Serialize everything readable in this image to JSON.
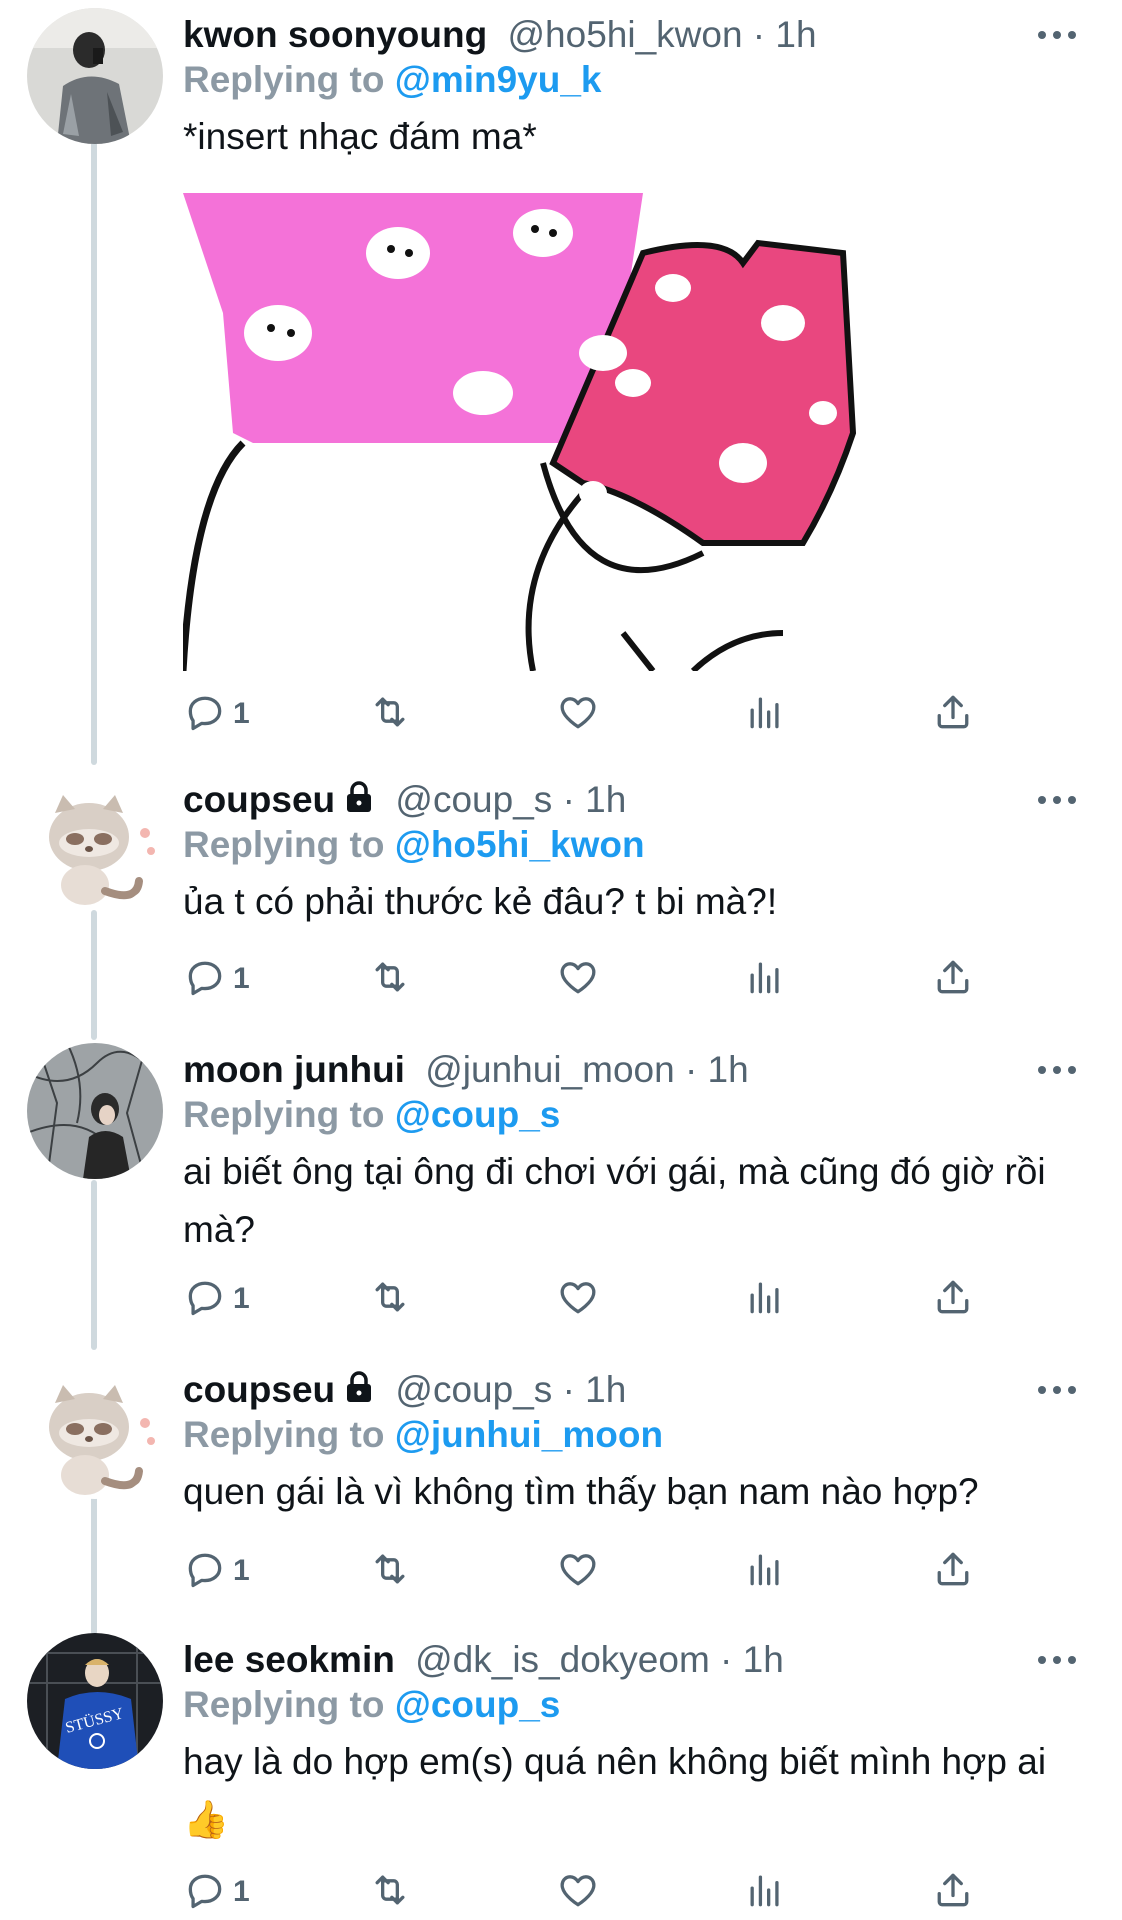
{
  "tweets": [
    {
      "name": "kwon soonyoung",
      "handle": "@ho5hi_kwon · 1h",
      "replying_prefix": "Replying to ",
      "replying_to": "@min9yu_k",
      "text": "*insert nhạc đám ma*",
      "has_media": true,
      "locked": false,
      "replies": "1"
    },
    {
      "name": "coupseu",
      "handle": "@coup_s · 1h",
      "replying_prefix": "Replying to ",
      "replying_to": "@ho5hi_kwon",
      "text": "ủa t có phải thước kẻ đâu? t bi mà?!",
      "locked": true,
      "replies": "1"
    },
    {
      "name": "moon junhui",
      "handle": "@junhui_moon · 1h",
      "replying_prefix": "Replying to ",
      "replying_to": "@coup_s",
      "text": "ai biết ông tại ông đi chơi với gái, mà cũng đó giờ rồi mà?",
      "locked": false,
      "replies": "1"
    },
    {
      "name": "coupseu",
      "handle": "@coup_s · 1h",
      "replying_prefix": "Replying to ",
      "replying_to": "@junhui_moon",
      "text": "quen gái là vì không tìm thấy bạn nam nào hợp?",
      "locked": true,
      "replies": "1"
    },
    {
      "name": "lee seokmin",
      "handle": "@dk_is_dokyeom · 1h",
      "replying_prefix": "Replying to ",
      "replying_to": "@coup_s",
      "text": "hay là do hợp em(s) quá nên không biết mình hợp ai👍",
      "locked": false,
      "replies": "1"
    }
  ],
  "icons": {
    "reply": "reply-icon",
    "retweet": "retweet-icon",
    "like": "heart-icon",
    "views": "analytics-icon",
    "share": "share-icon",
    "more": "more-dots-icon",
    "lock": "lock-icon"
  },
  "colors": {
    "mention": "#1d9bf0",
    "replying_label": "#8c99a4",
    "handle": "#536471",
    "icon": "#536471",
    "thread_line": "#cfd9de"
  }
}
